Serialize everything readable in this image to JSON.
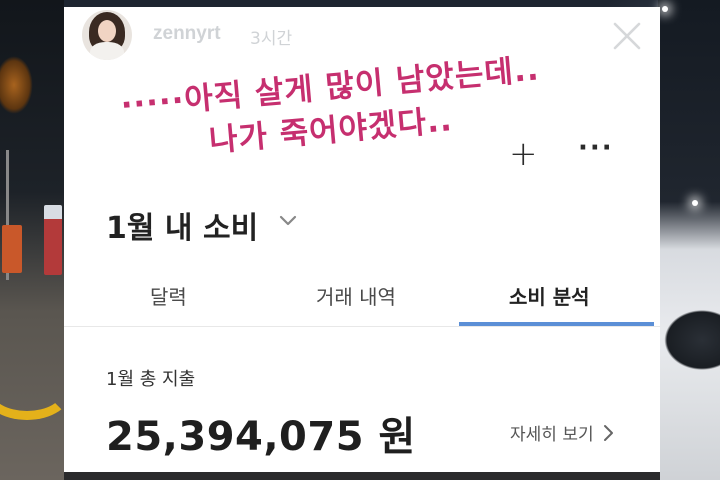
{
  "story": {
    "username": "zennyrt",
    "timestamp": "3시간",
    "caption_line1": "·····아직 살게 많이 남았는데..",
    "caption_line2": "나가 죽어야겠다..",
    "icons": {
      "close": "close-icon",
      "plus": "plus-icon",
      "more": "more-icon",
      "chevron": "chevron-down-icon"
    }
  },
  "app": {
    "month_title": "1월 내 소비",
    "tabs": [
      {
        "label": "달력",
        "selected": false
      },
      {
        "label": "거래 내역",
        "selected": false
      },
      {
        "label": "소비 분석",
        "selected": true
      }
    ],
    "summary": {
      "label": "1월 총 지출",
      "amount": "25,394,075 원",
      "detail_link": "자세히 보기"
    },
    "colors": {
      "caption": "#c62f6f",
      "tab_underline": "#5b8fd6"
    }
  }
}
